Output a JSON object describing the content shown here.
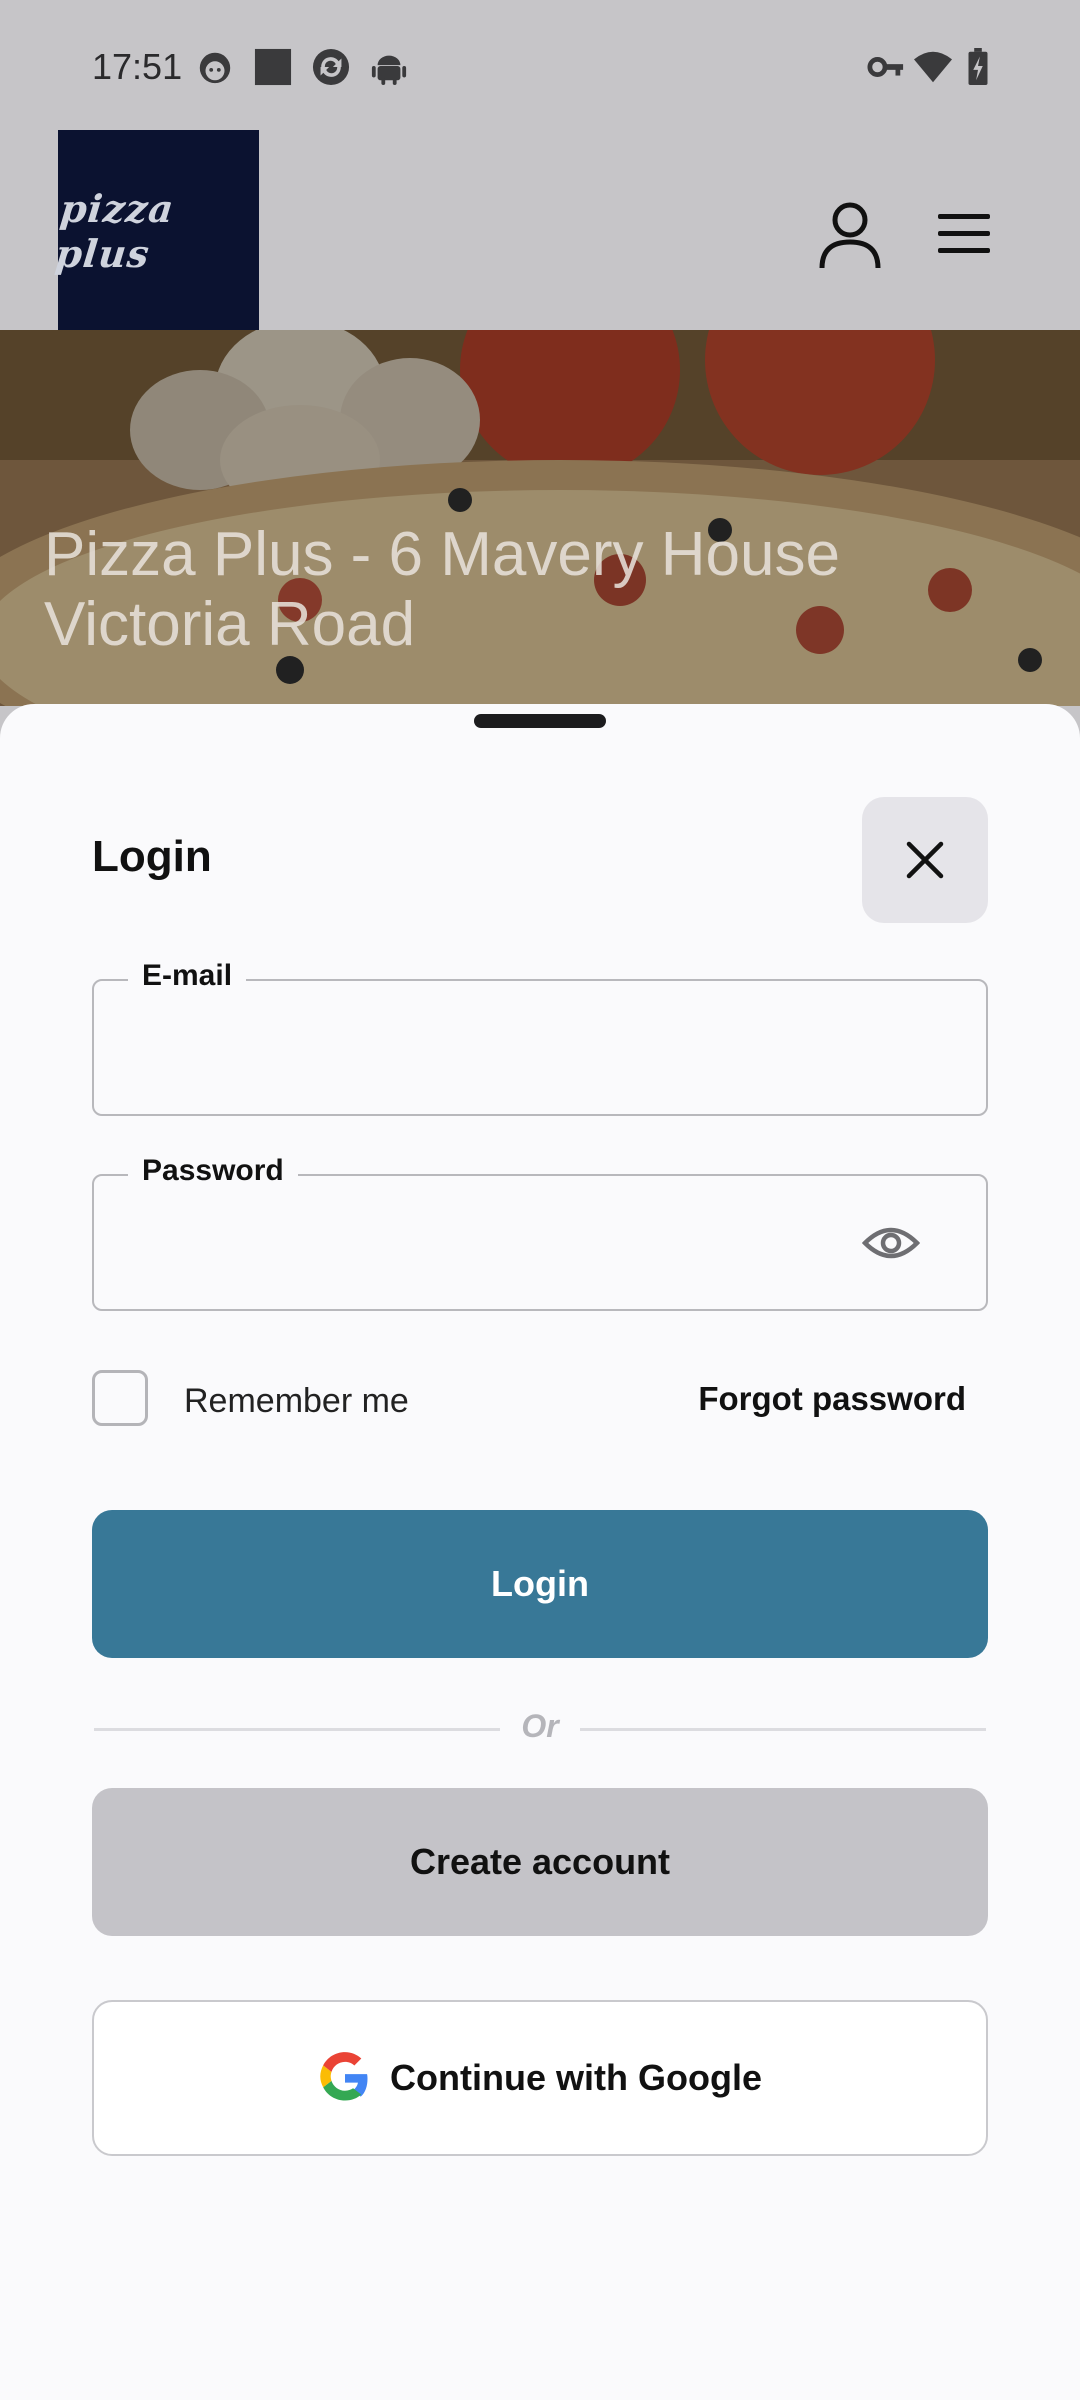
{
  "status_bar": {
    "time": "17:51",
    "left_icons": [
      "face-icon",
      "square-icon",
      "sync-icon",
      "android-icon"
    ],
    "right_icons": [
      "key-icon",
      "wifi-icon",
      "battery-icon"
    ]
  },
  "header": {
    "logo_text": "pizza plus",
    "icons": [
      "user-icon",
      "menu-icon"
    ]
  },
  "hero": {
    "title": "Pizza Plus - 6 Mavery House Victoria Road"
  },
  "login_sheet": {
    "title": "Login",
    "email": {
      "label": "E-mail",
      "value": "",
      "placeholder": ""
    },
    "password": {
      "label": "Password",
      "value": "",
      "placeholder": ""
    },
    "remember_me": {
      "label": "Remember me",
      "checked": false
    },
    "forgot_password": "Forgot password",
    "login_button": "Login",
    "divider_text": "Or",
    "create_account_button": "Create account",
    "google_button": "Continue with Google"
  },
  "colors": {
    "primary": "#387897",
    "secondary_button": "#c4c3c8",
    "background_dim": "#c6c5c8",
    "sheet": "#fafafc",
    "logo_bg": "#0b1230"
  }
}
